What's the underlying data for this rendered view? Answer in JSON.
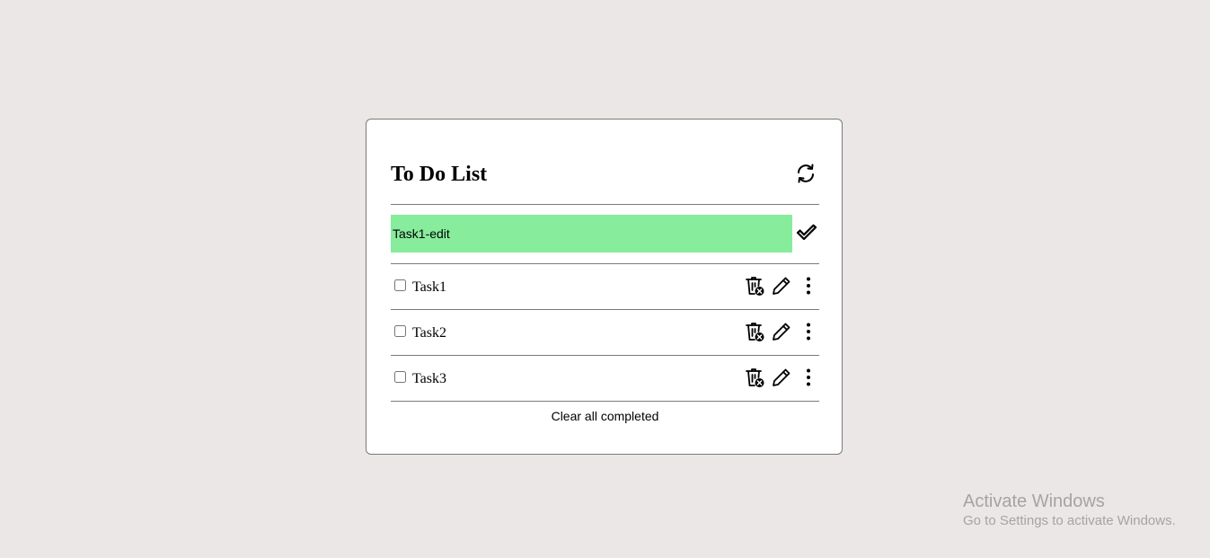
{
  "app": {
    "title": "To Do List"
  },
  "icons": {
    "refresh": "refresh-icon",
    "confirm": "check-icon",
    "delete": "trash-icon",
    "edit": "pencil-icon",
    "more": "more-vertical-icon"
  },
  "editor": {
    "value": "Task1-edit"
  },
  "tasks": [
    {
      "label": "Task1",
      "checked": false
    },
    {
      "label": "Task2",
      "checked": false
    },
    {
      "label": "Task3",
      "checked": false
    }
  ],
  "footer": {
    "clear_label": "Clear all completed"
  },
  "watermark": {
    "title": "Activate Windows",
    "subtitle": "Go to Settings to activate Windows."
  },
  "colors": {
    "page_background": "#ebe7e6",
    "card_background": "#ffffff",
    "edit_highlight": "#87ec9c",
    "divider": "#7a7a7a",
    "watermark_text": "#a6a3a3"
  }
}
